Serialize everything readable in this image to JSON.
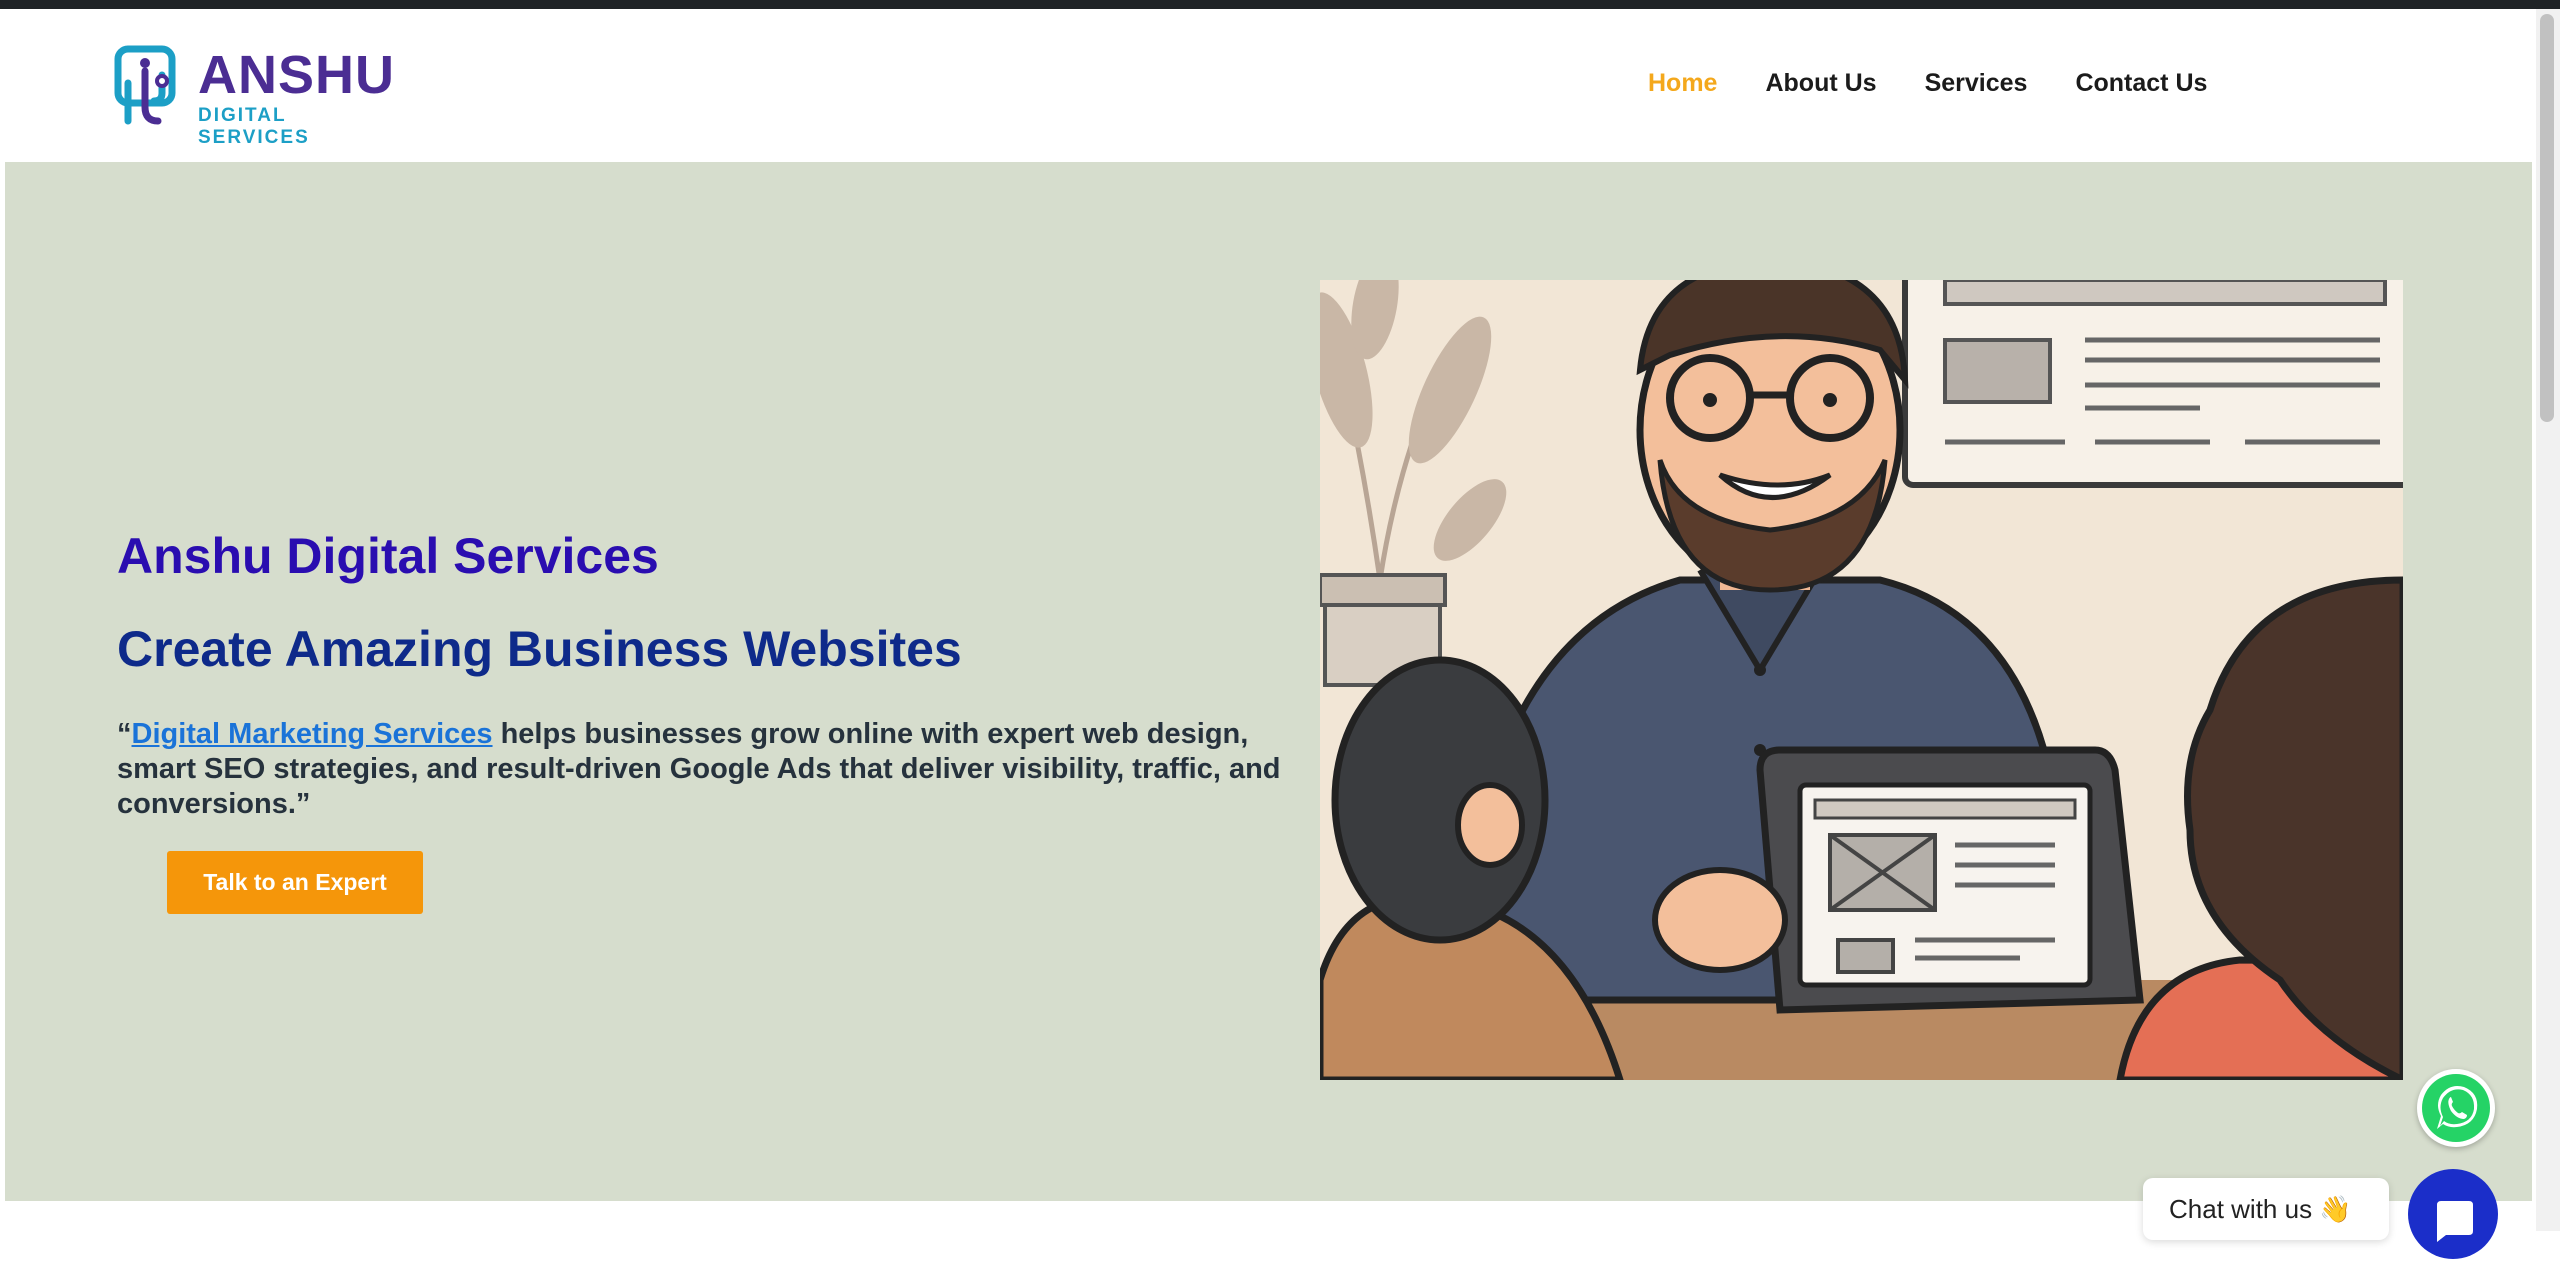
{
  "brand": {
    "name": "ANSHU",
    "tagline": "DIGITAL SERVICES"
  },
  "nav": [
    {
      "label": "Home",
      "active": true
    },
    {
      "label": "About Us",
      "active": false
    },
    {
      "label": "Services",
      "active": false
    },
    {
      "label": "Contact Us",
      "active": false
    }
  ],
  "hero": {
    "name": "Anshu Digital Services",
    "title": "Create Amazing Business Websites",
    "quote_open": "“",
    "link_text": "Digital Marketing Services",
    "desc_rest": " helps businesses grow online with expert web design, smart SEO strategies, and result-driven Google Ads that deliver visibility, traffic, and conversions.”",
    "cta_label": "Talk to an Expert"
  },
  "chat": {
    "label": "Chat with us",
    "emoji": "👋"
  },
  "colors": {
    "accent": "#f5960a",
    "hero_bg": "#d6ddcd",
    "brand_purple": "#4b2d93",
    "brand_teal": "#1c9fc6",
    "chat_blue": "#1b2ec9",
    "whatsapp_green": "#25d366"
  },
  "icons": {
    "whatsapp": "whatsapp-icon",
    "chat": "chat-icon"
  }
}
